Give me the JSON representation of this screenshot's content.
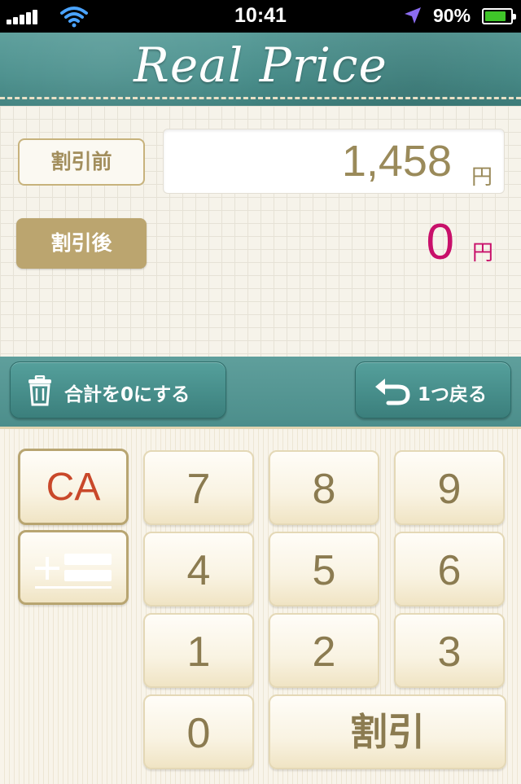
{
  "status_bar": {
    "time": "10:41",
    "battery_percent": "90%",
    "battery_level": 0.9
  },
  "header": {
    "title": "Real Price"
  },
  "display": {
    "label_before": "割引前",
    "label_after": "割引後",
    "before_value": "1,458",
    "before_unit": "円",
    "after_value": "0",
    "after_unit": "円"
  },
  "actions": {
    "clear_total": "合計を0にする",
    "undo": "1つ戻る"
  },
  "keypad": {
    "ca": "CA",
    "keys": [
      "7",
      "8",
      "9",
      "4",
      "5",
      "6",
      "1",
      "2",
      "3",
      "0"
    ],
    "discount": "割引"
  },
  "colors": {
    "header_teal": "#4a8f8c",
    "accent_magenta": "#c8106a",
    "label_gold": "#bba56f",
    "ca_red": "#c9482a"
  },
  "icons": {
    "clear": "trash-icon",
    "undo": "undo-arrow-icon",
    "plus_equals": "plus-equals-icon"
  }
}
